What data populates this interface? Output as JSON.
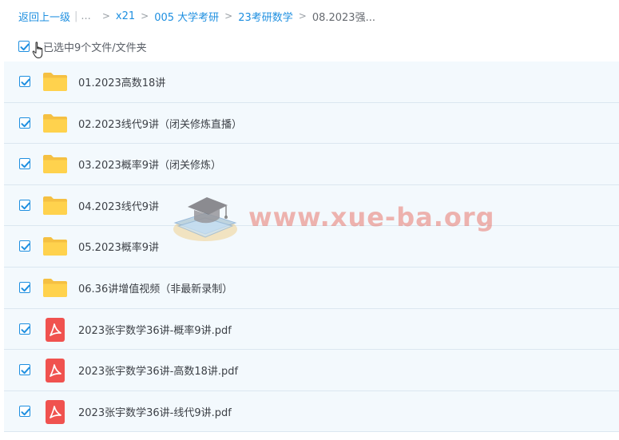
{
  "breadcrumb": {
    "back_label": "返回上一级",
    "separator_bar": "|",
    "ellipsis": "...",
    "separator": ">",
    "items": [
      "x21",
      "005 大学考研",
      "23考研数学"
    ],
    "current": "08.2023强..."
  },
  "selection": {
    "checked": true,
    "text": "已选中9个文件/文件夹"
  },
  "files": [
    {
      "name": "01.2023高数18讲",
      "type": "folder",
      "checked": true
    },
    {
      "name": "02.2023线代9讲（闭关修炼直播）",
      "type": "folder",
      "checked": true
    },
    {
      "name": "03.2023概率9讲（闭关修炼）",
      "type": "folder",
      "checked": true
    },
    {
      "name": "04.2023线代9讲",
      "type": "folder",
      "checked": true
    },
    {
      "name": "05.2023概率9讲",
      "type": "folder",
      "checked": true
    },
    {
      "name": "06.36讲增值视频（非最新录制）",
      "type": "folder",
      "checked": true
    },
    {
      "name": "2023张宇数学36讲-概率9讲.pdf",
      "type": "pdf",
      "checked": true
    },
    {
      "name": "2023张宇数学36讲-高数18讲.pdf",
      "type": "pdf",
      "checked": true
    },
    {
      "name": "2023张宇数学36讲-线代9讲.pdf",
      "type": "pdf",
      "checked": true
    }
  ],
  "watermark": {
    "text": "www.xue-ba.org",
    "icon": "graduation-cap-books-icon"
  },
  "colors": {
    "link": "#1e8fe0",
    "row_bg": "#f3f9fd",
    "folder": "#ffd24d",
    "pdf": "#f0524f"
  }
}
